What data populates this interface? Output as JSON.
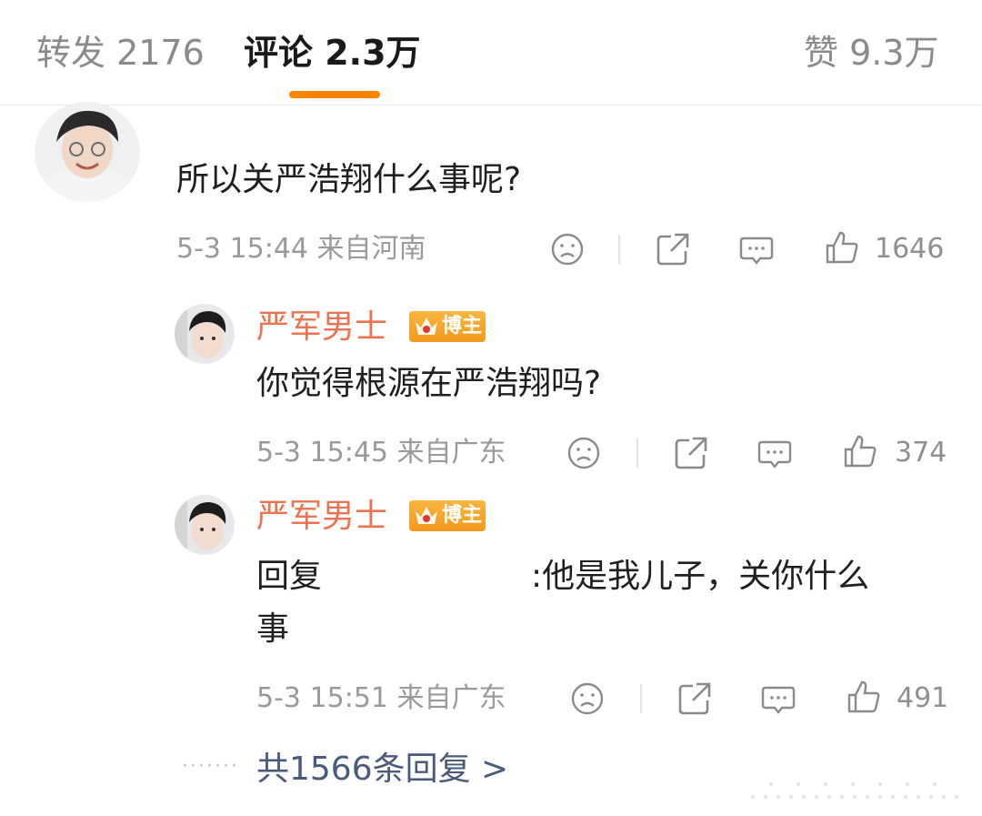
{
  "tabs": {
    "repost": "转发 2176",
    "comments": "评论 2.3万",
    "likes": "赞 9.3万"
  },
  "main_comment": {
    "text": "所以关严浩翔什么事呢?",
    "meta": "5-3 15:44  来自河南",
    "like_count": "1646"
  },
  "replies": [
    {
      "username": "严军男士",
      "badge": "博主",
      "text": "你觉得根源在严浩翔吗?",
      "meta": "5-3 15:45  来自广东",
      "like_count": "374"
    },
    {
      "username": "严军男士",
      "badge": "博主",
      "text_prefix": "回复",
      "text_line1": ":他是我儿子，关你什么",
      "text_line2": "事",
      "meta": "5-3 15:51  来自广东",
      "like_count": "491"
    }
  ],
  "more_replies": "共1566条回复 >",
  "colors": {
    "accent": "#ff8200",
    "username": "#eb7350",
    "link": "#4a5a7a"
  },
  "icons": [
    "sad-face-icon",
    "repost-icon",
    "comment-icon",
    "like-thumb-icon",
    "crown-icon"
  ]
}
